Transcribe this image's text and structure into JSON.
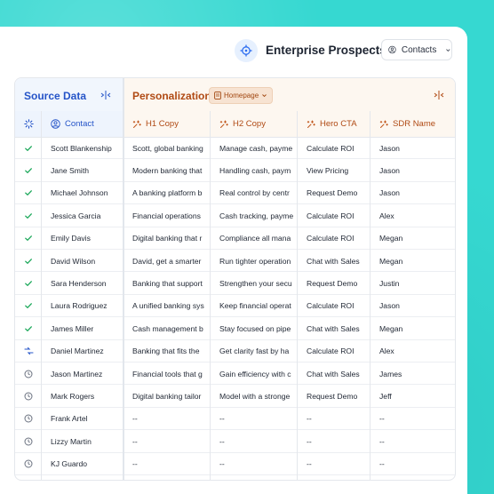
{
  "header": {
    "title": "Enterprise Prospects",
    "contacts_button": "Contacts"
  },
  "source": {
    "title": "Source Data",
    "contact_col": "Contact"
  },
  "personalization": {
    "title": "Personalization",
    "chip": "Homepage",
    "columns": [
      "H1 Copy",
      "H2 Copy",
      "Hero CTA",
      "SDR Name"
    ]
  },
  "rows": [
    {
      "status": "done",
      "contact": "Scott Blankenship",
      "h1": "Scott, global banking",
      "h2": "Manage cash, payme",
      "cta": "Calculate  ROI",
      "sdr": "Jason"
    },
    {
      "status": "done",
      "contact": "Jane Smith",
      "h1": "Modern banking that",
      "h2": "Handling cash, paym",
      "cta": "View Pricing",
      "sdr": "Jason"
    },
    {
      "status": "done",
      "contact": "Michael Johnson",
      "h1": "A banking platform b",
      "h2": "Real control by centr",
      "cta": "Request Demo",
      "sdr": "Jason"
    },
    {
      "status": "done",
      "contact": "Jessica Garcia",
      "h1": "Financial operations",
      "h2": "Cash tracking, payme",
      "cta": "Calculate  ROI",
      "sdr": "Alex"
    },
    {
      "status": "done",
      "contact": "Emily Davis",
      "h1": "Digital banking that r",
      "h2": "Compliance all mana",
      "cta": "Calculate  ROI",
      "sdr": "Megan"
    },
    {
      "status": "done",
      "contact": "David Wilson",
      "h1": "David, get a smarter",
      "h2": "Run tighter operation",
      "cta": "Chat with Sales",
      "sdr": "Megan"
    },
    {
      "status": "done",
      "contact": "Sara Henderson",
      "h1": "Banking that support",
      "h2": "Strengthen your secu",
      "cta": "Request Demo",
      "sdr": "Justin"
    },
    {
      "status": "done",
      "contact": "Laura Rodriguez",
      "h1": "A unified banking sys",
      "h2": "Keep financial operat",
      "cta": "Calculate  ROI",
      "sdr": "Jason"
    },
    {
      "status": "done",
      "contact": "James Miller",
      "h1": "Cash management b",
      "h2": "Stay focused on pipe",
      "cta": "Chat with Sales",
      "sdr": "Megan"
    },
    {
      "status": "running",
      "contact": "Daniel Martinez",
      "h1": "Banking that fits the",
      "h2": "Get clarity fast by ha",
      "cta": "Calculate  ROI",
      "sdr": "Alex"
    },
    {
      "status": "pending",
      "contact": "Jason Martinez",
      "h1": "Financial tools that g",
      "h2": "Gain efficiency with c",
      "cta": "Chat with Sales",
      "sdr": "James"
    },
    {
      "status": "pending",
      "contact": "Mark Rogers",
      "h1": "Digital banking tailor",
      "h2": "Model with a stronge",
      "cta": "Request Demo",
      "sdr": "Jeff"
    },
    {
      "status": "pending",
      "contact": "Frank Artel",
      "h1": "--",
      "h2": "--",
      "cta": "--",
      "sdr": "--"
    },
    {
      "status": "pending",
      "contact": "Lizzy Martin",
      "h1": "--",
      "h2": "--",
      "cta": "--",
      "sdr": "--"
    },
    {
      "status": "pending",
      "contact": "KJ Guardo",
      "h1": "--",
      "h2": "--",
      "cta": "--",
      "sdr": "--"
    }
  ],
  "colors": {
    "background": "#36d8d1",
    "source_accent": "#2554c8",
    "personalization_accent": "#b04a14",
    "check": "#1ca85a"
  }
}
